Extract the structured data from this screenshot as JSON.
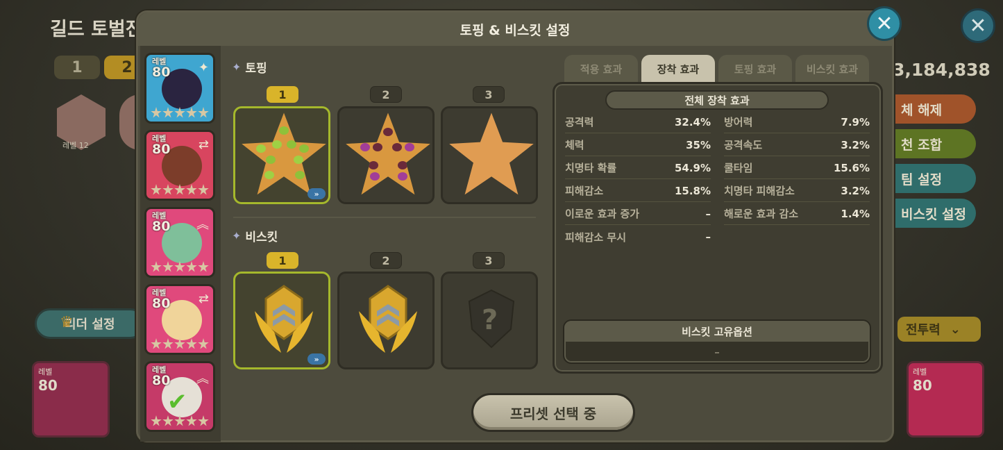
{
  "background": {
    "title": "길드 토벌전",
    "tabs": [
      "1",
      "2"
    ],
    "hex_level": "레벨 12",
    "leader_button": "리더 설정",
    "score": "3,184,838",
    "side_buttons": [
      "체 해제",
      "천 조합",
      "팀 설정",
      "비스킷 설정"
    ],
    "power_dropdown": "전투력",
    "bottom_cards": [
      {
        "level_label": "레벨",
        "level": "80"
      },
      {
        "level_label": "레벨",
        "level": "80"
      }
    ]
  },
  "modal": {
    "title": "토핑 & 비스킷 설정",
    "close_icon": "close-icon",
    "cookies": [
      {
        "level_label": "레벨",
        "level": "80",
        "color": "#3fa6d0",
        "corner_icon": "wand-icon"
      },
      {
        "level_label": "레벨",
        "level": "80",
        "color": "#d8455f",
        "corner_icon": "swap-icon"
      },
      {
        "level_label": "레벨",
        "level": "80",
        "color": "#e0497c",
        "corner_icon": "chevron-up-icon"
      },
      {
        "level_label": "레벨",
        "level": "80",
        "color": "#e0497c",
        "corner_icon": "swap-icon"
      },
      {
        "level_label": "레벨",
        "level": "80",
        "color": "#c53a68",
        "corner_icon": "chevron-up-icon",
        "selected": true
      }
    ],
    "topping": {
      "label": "토핑",
      "slots": [
        {
          "num": "1",
          "active": true,
          "type": "green-bean-star"
        },
        {
          "num": "2",
          "active": false,
          "type": "purple-bean-star"
        },
        {
          "num": "3",
          "active": false,
          "type": "plain-star"
        }
      ]
    },
    "biscuit": {
      "label": "비스킷",
      "slots": [
        {
          "num": "1",
          "active": true,
          "type": "golden-biscuit"
        },
        {
          "num": "2",
          "active": false,
          "type": "golden-biscuit"
        },
        {
          "num": "3",
          "active": false,
          "type": "unknown-biscuit"
        }
      ],
      "unknown_mark": "?"
    },
    "more_icon": "»",
    "tabs": [
      {
        "label": "적용 효과",
        "active": false
      },
      {
        "label": "장착 효과",
        "active": true
      },
      {
        "label": "토핑 효과",
        "active": false
      },
      {
        "label": "비스킷 효과",
        "active": false
      }
    ],
    "effects": {
      "title": "전체 장착 효과",
      "left": [
        {
          "name": "공격력",
          "value": "32.4%"
        },
        {
          "name": "체력",
          "value": "35%"
        },
        {
          "name": "치명타 확률",
          "value": "54.9%"
        },
        {
          "name": "피해감소",
          "value": "15.8%"
        },
        {
          "name": "이로운 효과 증가",
          "value": "–"
        },
        {
          "name": "피해감소 무시",
          "value": "–"
        }
      ],
      "right": [
        {
          "name": "방어력",
          "value": "7.9%"
        },
        {
          "name": "공격속도",
          "value": "3.2%"
        },
        {
          "name": "쿨타임",
          "value": "15.6%"
        },
        {
          "name": "치명타 피해감소",
          "value": "3.2%"
        },
        {
          "name": "해로운 효과 감소",
          "value": "1.4%"
        }
      ],
      "unique_title": "비스킷 고유옵션",
      "unique_value": "–"
    },
    "preset_button": "프리셋 선택 중"
  }
}
